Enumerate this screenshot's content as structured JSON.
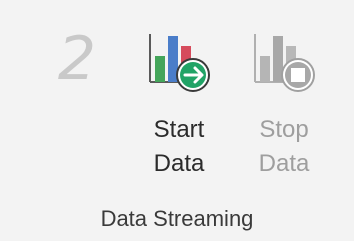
{
  "group": {
    "step_number": "2",
    "label": "Data Streaming"
  },
  "start_button": {
    "line1": "Start",
    "line2": "Data",
    "icon": "start-data-icon",
    "enabled": true
  },
  "stop_button": {
    "line1": "Stop",
    "line2": "Data",
    "icon": "stop-data-icon",
    "enabled": false
  },
  "colors": {
    "background": "#f3f3f3",
    "start_arrow_circle": "#21a366",
    "bar_green": "#44a55a",
    "bar_blue": "#4a7dc9",
    "bar_red": "#d64b5c",
    "disabled_gray": "#a8a8a8",
    "step_number": "#c9c9c9"
  }
}
